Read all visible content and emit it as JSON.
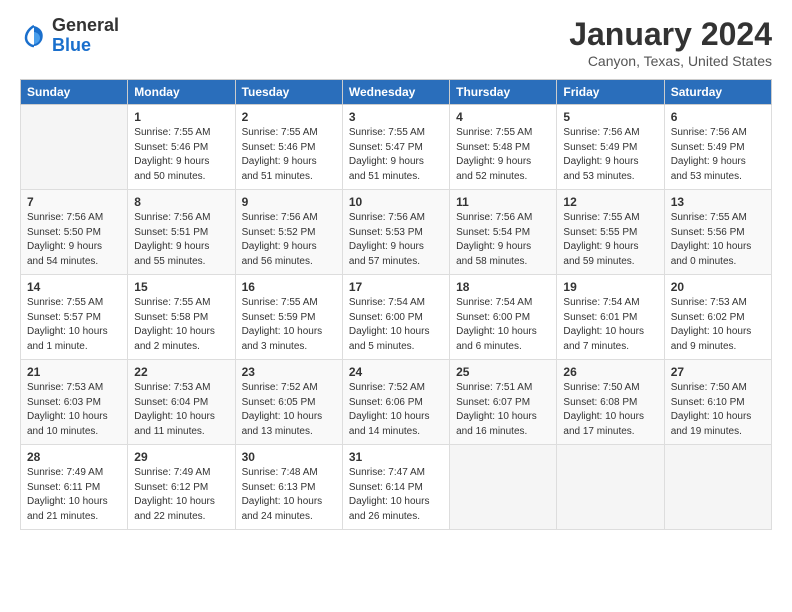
{
  "header": {
    "logo_general": "General",
    "logo_blue": "Blue",
    "month": "January 2024",
    "location": "Canyon, Texas, United States"
  },
  "weekdays": [
    "Sunday",
    "Monday",
    "Tuesday",
    "Wednesday",
    "Thursday",
    "Friday",
    "Saturday"
  ],
  "weeks": [
    [
      {
        "day": "",
        "sunrise": "",
        "sunset": "",
        "daylight": ""
      },
      {
        "day": "1",
        "sunrise": "Sunrise: 7:55 AM",
        "sunset": "Sunset: 5:46 PM",
        "daylight": "Daylight: 9 hours and 50 minutes."
      },
      {
        "day": "2",
        "sunrise": "Sunrise: 7:55 AM",
        "sunset": "Sunset: 5:46 PM",
        "daylight": "Daylight: 9 hours and 51 minutes."
      },
      {
        "day": "3",
        "sunrise": "Sunrise: 7:55 AM",
        "sunset": "Sunset: 5:47 PM",
        "daylight": "Daylight: 9 hours and 51 minutes."
      },
      {
        "day": "4",
        "sunrise": "Sunrise: 7:55 AM",
        "sunset": "Sunset: 5:48 PM",
        "daylight": "Daylight: 9 hours and 52 minutes."
      },
      {
        "day": "5",
        "sunrise": "Sunrise: 7:56 AM",
        "sunset": "Sunset: 5:49 PM",
        "daylight": "Daylight: 9 hours and 53 minutes."
      },
      {
        "day": "6",
        "sunrise": "Sunrise: 7:56 AM",
        "sunset": "Sunset: 5:49 PM",
        "daylight": "Daylight: 9 hours and 53 minutes."
      }
    ],
    [
      {
        "day": "7",
        "sunrise": "Sunrise: 7:56 AM",
        "sunset": "Sunset: 5:50 PM",
        "daylight": "Daylight: 9 hours and 54 minutes."
      },
      {
        "day": "8",
        "sunrise": "Sunrise: 7:56 AM",
        "sunset": "Sunset: 5:51 PM",
        "daylight": "Daylight: 9 hours and 55 minutes."
      },
      {
        "day": "9",
        "sunrise": "Sunrise: 7:56 AM",
        "sunset": "Sunset: 5:52 PM",
        "daylight": "Daylight: 9 hours and 56 minutes."
      },
      {
        "day": "10",
        "sunrise": "Sunrise: 7:56 AM",
        "sunset": "Sunset: 5:53 PM",
        "daylight": "Daylight: 9 hours and 57 minutes."
      },
      {
        "day": "11",
        "sunrise": "Sunrise: 7:56 AM",
        "sunset": "Sunset: 5:54 PM",
        "daylight": "Daylight: 9 hours and 58 minutes."
      },
      {
        "day": "12",
        "sunrise": "Sunrise: 7:55 AM",
        "sunset": "Sunset: 5:55 PM",
        "daylight": "Daylight: 9 hours and 59 minutes."
      },
      {
        "day": "13",
        "sunrise": "Sunrise: 7:55 AM",
        "sunset": "Sunset: 5:56 PM",
        "daylight": "Daylight: 10 hours and 0 minutes."
      }
    ],
    [
      {
        "day": "14",
        "sunrise": "Sunrise: 7:55 AM",
        "sunset": "Sunset: 5:57 PM",
        "daylight": "Daylight: 10 hours and 1 minute."
      },
      {
        "day": "15",
        "sunrise": "Sunrise: 7:55 AM",
        "sunset": "Sunset: 5:58 PM",
        "daylight": "Daylight: 10 hours and 2 minutes."
      },
      {
        "day": "16",
        "sunrise": "Sunrise: 7:55 AM",
        "sunset": "Sunset: 5:59 PM",
        "daylight": "Daylight: 10 hours and 3 minutes."
      },
      {
        "day": "17",
        "sunrise": "Sunrise: 7:54 AM",
        "sunset": "Sunset: 6:00 PM",
        "daylight": "Daylight: 10 hours and 5 minutes."
      },
      {
        "day": "18",
        "sunrise": "Sunrise: 7:54 AM",
        "sunset": "Sunset: 6:00 PM",
        "daylight": "Daylight: 10 hours and 6 minutes."
      },
      {
        "day": "19",
        "sunrise": "Sunrise: 7:54 AM",
        "sunset": "Sunset: 6:01 PM",
        "daylight": "Daylight: 10 hours and 7 minutes."
      },
      {
        "day": "20",
        "sunrise": "Sunrise: 7:53 AM",
        "sunset": "Sunset: 6:02 PM",
        "daylight": "Daylight: 10 hours and 9 minutes."
      }
    ],
    [
      {
        "day": "21",
        "sunrise": "Sunrise: 7:53 AM",
        "sunset": "Sunset: 6:03 PM",
        "daylight": "Daylight: 10 hours and 10 minutes."
      },
      {
        "day": "22",
        "sunrise": "Sunrise: 7:53 AM",
        "sunset": "Sunset: 6:04 PM",
        "daylight": "Daylight: 10 hours and 11 minutes."
      },
      {
        "day": "23",
        "sunrise": "Sunrise: 7:52 AM",
        "sunset": "Sunset: 6:05 PM",
        "daylight": "Daylight: 10 hours and 13 minutes."
      },
      {
        "day": "24",
        "sunrise": "Sunrise: 7:52 AM",
        "sunset": "Sunset: 6:06 PM",
        "daylight": "Daylight: 10 hours and 14 minutes."
      },
      {
        "day": "25",
        "sunrise": "Sunrise: 7:51 AM",
        "sunset": "Sunset: 6:07 PM",
        "daylight": "Daylight: 10 hours and 16 minutes."
      },
      {
        "day": "26",
        "sunrise": "Sunrise: 7:50 AM",
        "sunset": "Sunset: 6:08 PM",
        "daylight": "Daylight: 10 hours and 17 minutes."
      },
      {
        "day": "27",
        "sunrise": "Sunrise: 7:50 AM",
        "sunset": "Sunset: 6:10 PM",
        "daylight": "Daylight: 10 hours and 19 minutes."
      }
    ],
    [
      {
        "day": "28",
        "sunrise": "Sunrise: 7:49 AM",
        "sunset": "Sunset: 6:11 PM",
        "daylight": "Daylight: 10 hours and 21 minutes."
      },
      {
        "day": "29",
        "sunrise": "Sunrise: 7:49 AM",
        "sunset": "Sunset: 6:12 PM",
        "daylight": "Daylight: 10 hours and 22 minutes."
      },
      {
        "day": "30",
        "sunrise": "Sunrise: 7:48 AM",
        "sunset": "Sunset: 6:13 PM",
        "daylight": "Daylight: 10 hours and 24 minutes."
      },
      {
        "day": "31",
        "sunrise": "Sunrise: 7:47 AM",
        "sunset": "Sunset: 6:14 PM",
        "daylight": "Daylight: 10 hours and 26 minutes."
      },
      {
        "day": "",
        "sunrise": "",
        "sunset": "",
        "daylight": ""
      },
      {
        "day": "",
        "sunrise": "",
        "sunset": "",
        "daylight": ""
      },
      {
        "day": "",
        "sunrise": "",
        "sunset": "",
        "daylight": ""
      }
    ]
  ]
}
